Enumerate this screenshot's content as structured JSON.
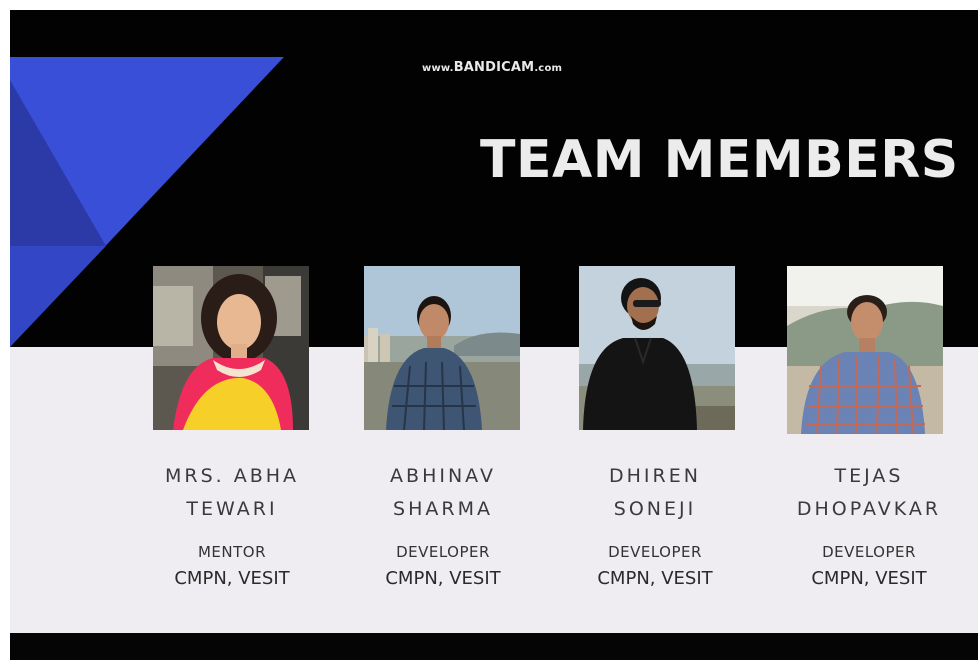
{
  "watermark": {
    "prefix": "www.",
    "brand": "BANDICAM",
    "suffix": ".com"
  },
  "title": "TEAM MEMBERS",
  "members": [
    {
      "name_line1": "MRS. ABHA",
      "name_line2": "TEWARI",
      "role": "MENTOR",
      "dept": "CMPN, VESIT"
    },
    {
      "name_line1": "ABHINAV",
      "name_line2": "SHARMA",
      "role": "DEVELOPER",
      "dept": "CMPN, VESIT"
    },
    {
      "name_line1": "DHIREN",
      "name_line2": "SONEJI",
      "role": "DEVELOPER",
      "dept": "CMPN, VESIT"
    },
    {
      "name_line1": "TEJAS",
      "name_line2": "DHOPAVKAR",
      "role": "DEVELOPER",
      "dept": "CMPN, VESIT"
    }
  ],
  "colors": {
    "deco_blue": "#3a4fd8",
    "deco_blue_dark": "#2a3aa8",
    "dark_band": "#020202",
    "light_band": "#efedf1"
  }
}
